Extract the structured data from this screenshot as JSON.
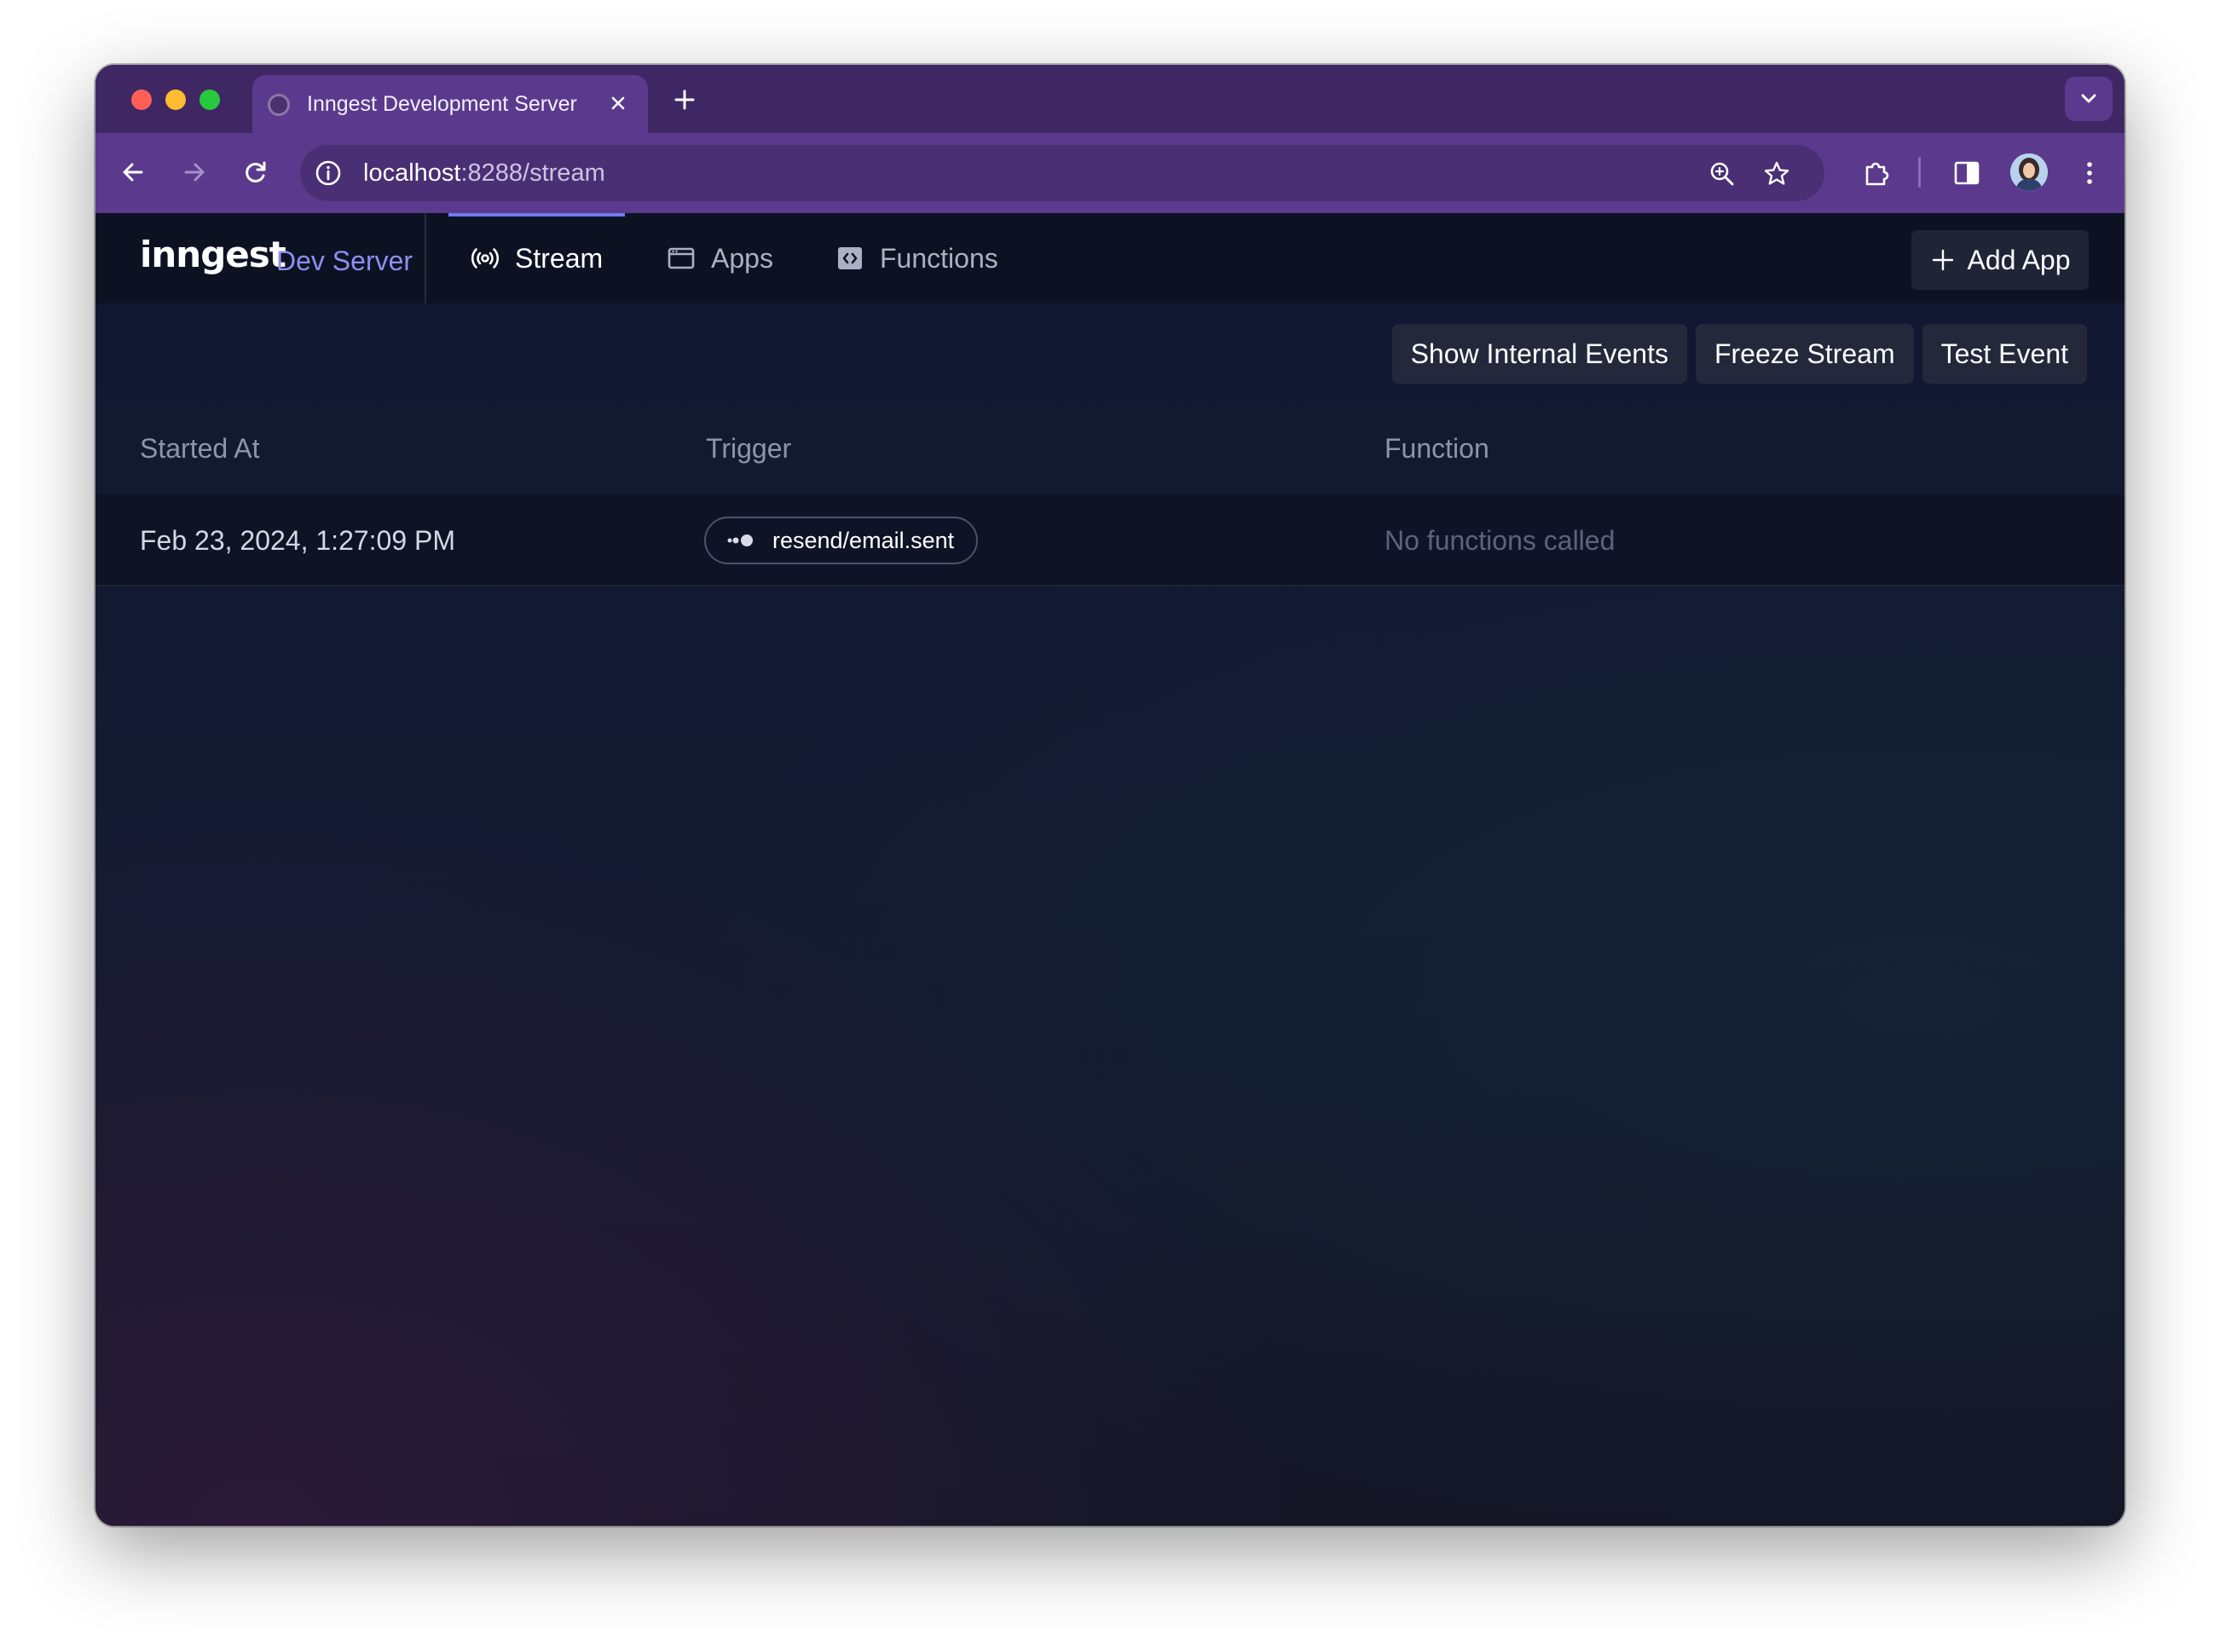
{
  "browser": {
    "tab_title": "Inngest Development Server",
    "url_host": "localhost",
    "url_path": ":8288/stream"
  },
  "app": {
    "logo": "inngest",
    "logo_sub": "Dev Server",
    "nav": [
      {
        "label": "Stream",
        "icon": "broadcast-icon",
        "active": true
      },
      {
        "label": "Apps",
        "icon": "app-window-icon",
        "active": false
      },
      {
        "label": "Functions",
        "icon": "code-icon",
        "active": false
      }
    ],
    "add_app_label": "Add App",
    "actions": {
      "show_internal": "Show Internal Events",
      "freeze": "Freeze Stream",
      "test_event": "Test Event"
    },
    "table": {
      "headers": [
        "Started At",
        "Trigger",
        "Function"
      ],
      "rows": [
        {
          "started_at": "Feb 23, 2024, 1:27:09 PM",
          "trigger": "resend/email.sent",
          "function": "No functions called"
        }
      ]
    }
  },
  "colors": {
    "tab_strip": "#3f2763",
    "toolbar": "#5b3a8d",
    "accent": "#6f7bf0",
    "app_bg": "#12172a"
  }
}
